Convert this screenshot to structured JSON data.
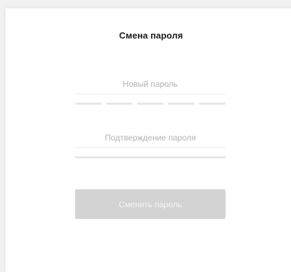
{
  "form": {
    "title": "Смена пароля",
    "new_password": {
      "value": "",
      "placeholder": "Новый пароль"
    },
    "confirm_password": {
      "value": "",
      "placeholder": "Подтверждение пароля"
    },
    "submit_label": "Сменить пароль"
  },
  "colors": {
    "button_disabled_bg": "#d3d3d3",
    "bar_inactive": "#e6e6e6",
    "placeholder": "#b3b3b3"
  }
}
